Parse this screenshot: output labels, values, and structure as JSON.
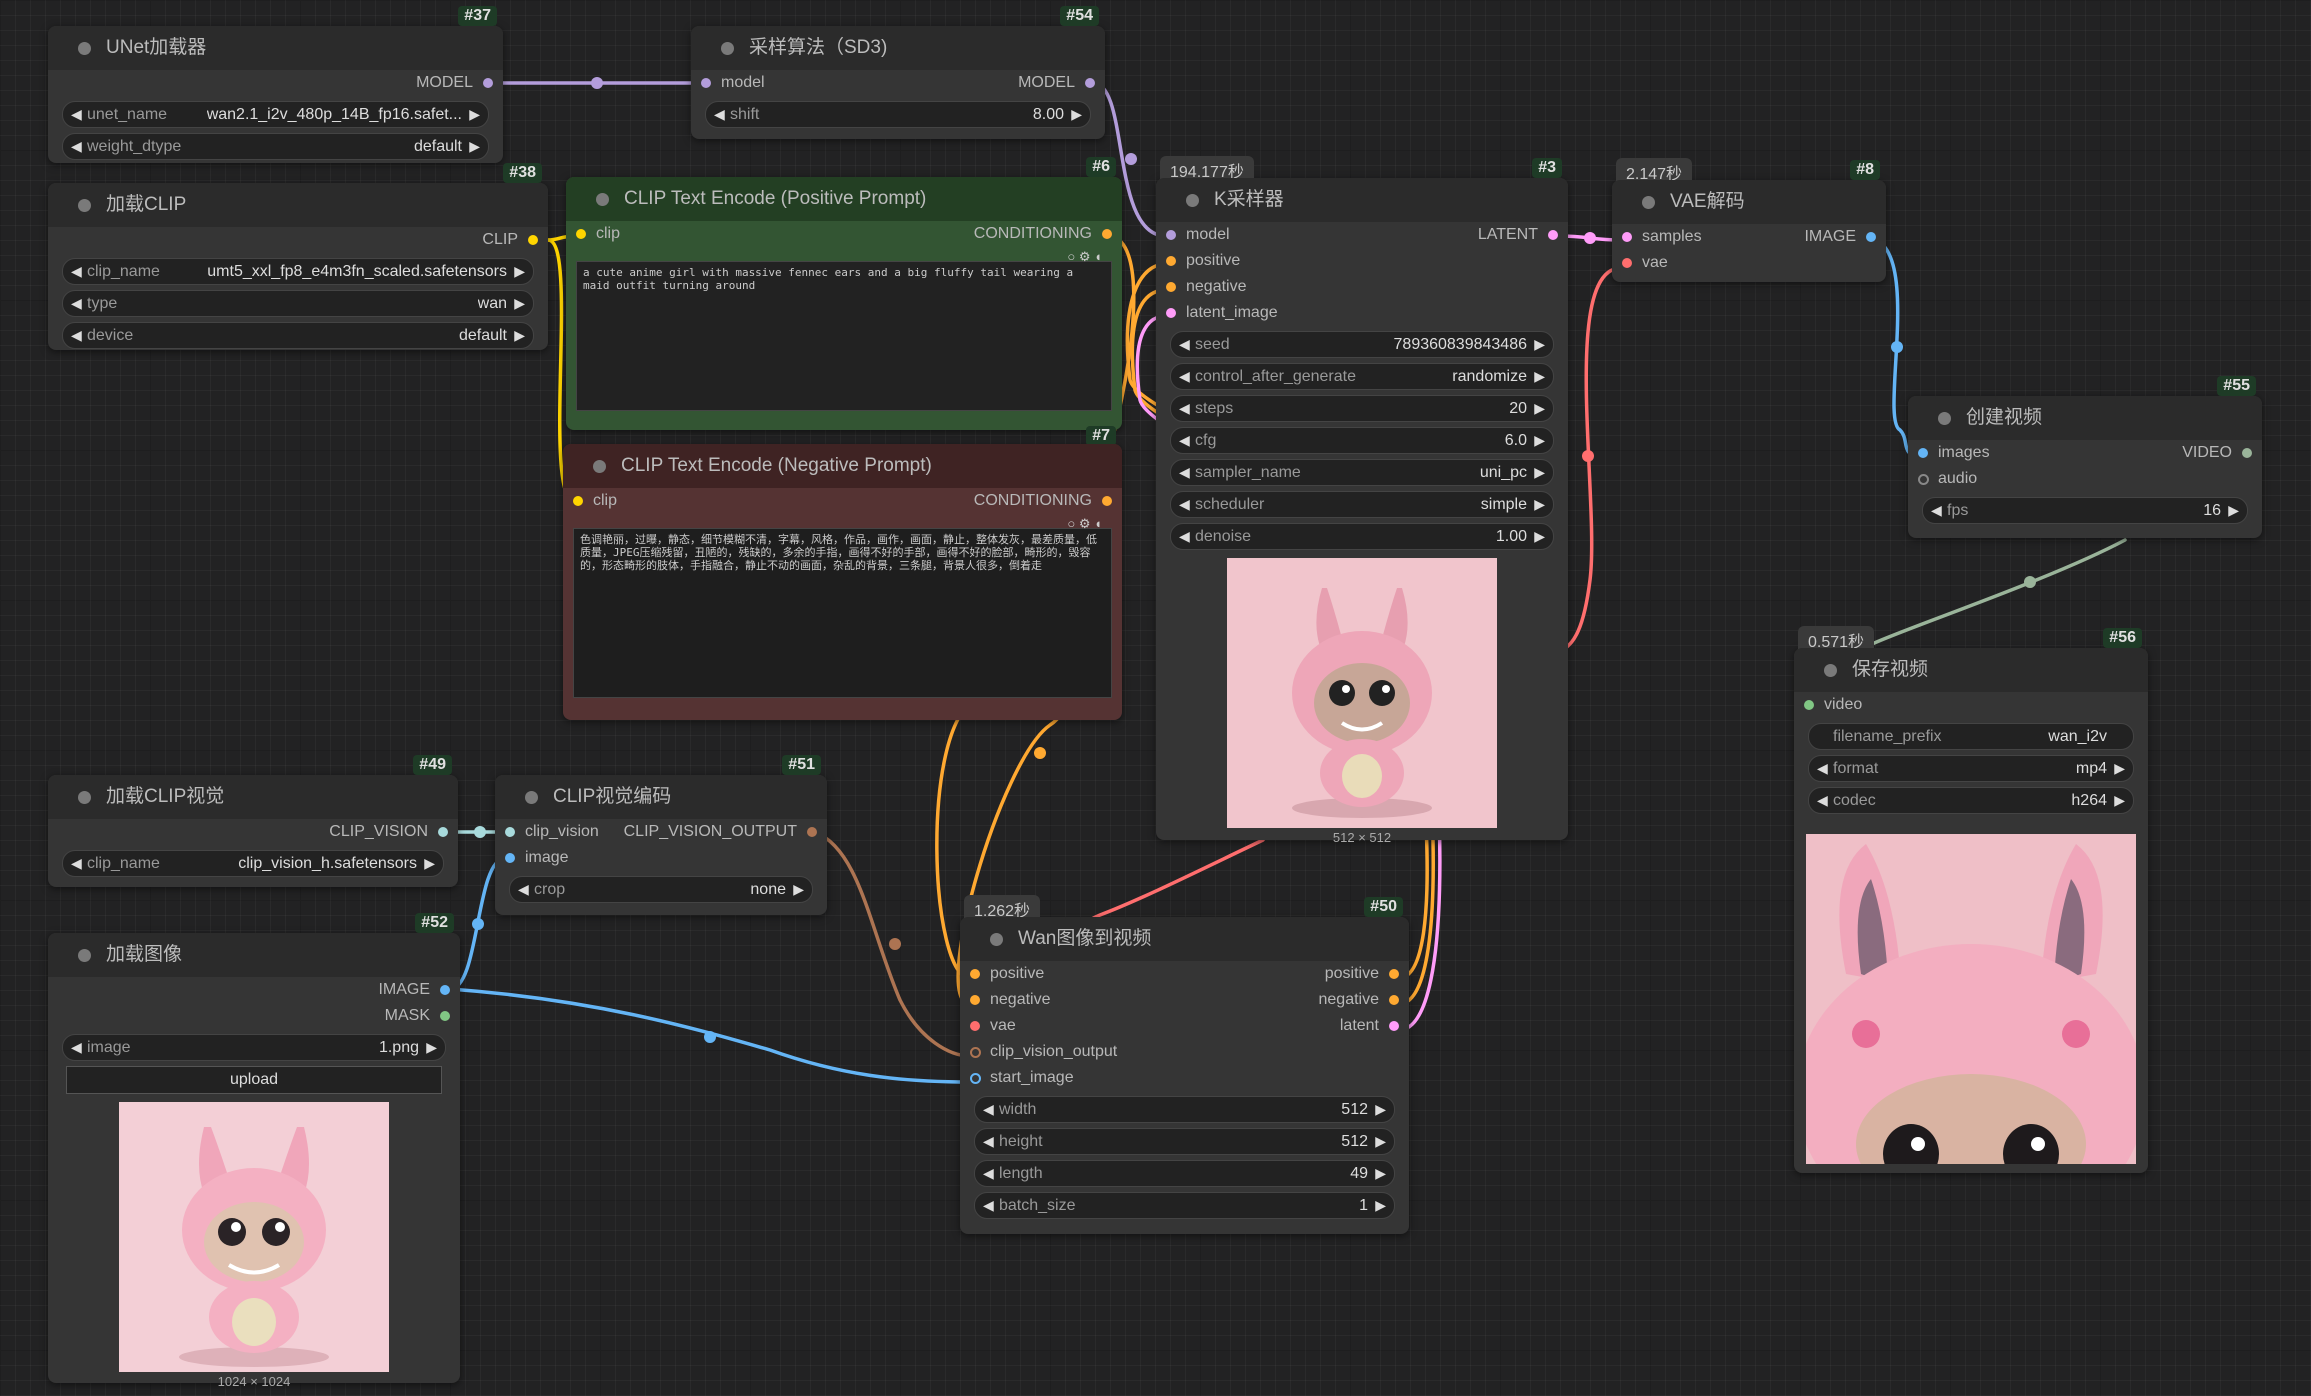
{
  "nodes": {
    "unet": {
      "id": "#37",
      "title": "UNet加载器",
      "out": "MODEL",
      "w1": {
        "label": "unet_name",
        "value": "wan2.1_i2v_480p_14B_fp16.safet..."
      },
      "w2": {
        "label": "weight_dtype",
        "value": "default"
      }
    },
    "sd3": {
      "id": "#54",
      "title": "采样算法（SD3)",
      "in": "model",
      "out": "MODEL",
      "w1": {
        "label": "shift",
        "value": "8.00"
      }
    },
    "clipload": {
      "id": "#38",
      "title": "加载CLIP",
      "out": "CLIP",
      "w1": {
        "label": "clip_name",
        "value": "umt5_xxl_fp8_e4m3fn_scaled.safetensors"
      },
      "w2": {
        "label": "type",
        "value": "wan"
      },
      "w3": {
        "label": "device",
        "value": "default"
      }
    },
    "pos": {
      "id": "#6",
      "title": "CLIP Text Encode (Positive Prompt)",
      "in": "clip",
      "out": "CONDITIONING",
      "text": "a cute anime girl with massive fennec ears and a big fluffy tail wearing a maid outfit turning around"
    },
    "neg": {
      "id": "#7",
      "title": "CLIP Text Encode (Negative Prompt)",
      "in": "clip",
      "out": "CONDITIONING",
      "text": "色调艳丽，过曝，静态，细节模糊不清，字幕，风格，作品，画作，画面，静止，整体发灰，最差质量，低质量，JPEG压缩残留，丑陋的，残缺的，多余的手指，画得不好的手部，画得不好的脸部，畸形的，毁容的，形态畸形的肢体，手指融合，静止不动的画面，杂乱的背景，三条腿，背景人很多，倒着走"
    },
    "ksampler": {
      "id": "#3",
      "title": "K采样器",
      "time": "194.177秒",
      "out": "LATENT",
      "inputs": [
        "model",
        "positive",
        "negative",
        "latent_image"
      ],
      "widgets": [
        {
          "label": "seed",
          "value": "789360839843486"
        },
        {
          "label": "control_after_generate",
          "value": "randomize"
        },
        {
          "label": "steps",
          "value": "20"
        },
        {
          "label": "cfg",
          "value": "6.0"
        },
        {
          "label": "sampler_name",
          "value": "uni_pc"
        },
        {
          "label": "scheduler",
          "value": "simple"
        },
        {
          "label": "denoise",
          "value": "1.00"
        }
      ],
      "caption": "512 × 512"
    },
    "vae": {
      "id": "#8",
      "title": "VAE解码",
      "time": "2.147秒",
      "in1": "samples",
      "in2": "vae",
      "out": "IMAGE"
    },
    "video": {
      "id": "#55",
      "title": "创建视频",
      "in1": "images",
      "in2": "audio",
      "out": "VIDEO",
      "w1": {
        "label": "fps",
        "value": "16"
      }
    },
    "save": {
      "id": "#56",
      "title": "保存视频",
      "time": "0.571秒",
      "in": "video",
      "w1": {
        "label": "filename_prefix",
        "value": "wan_i2v"
      },
      "w2": {
        "label": "format",
        "value": "mp4"
      },
      "w3": {
        "label": "codec",
        "value": "h264"
      }
    },
    "clipvis": {
      "id": "#49",
      "title": "加载CLIP视觉",
      "out": "CLIP_VISION",
      "w1": {
        "label": "clip_name",
        "value": "clip_vision_h.safetensors"
      }
    },
    "cvenc": {
      "id": "#51",
      "title": "CLIP视觉编码",
      "in1": "clip_vision",
      "in2": "image",
      "out": "CLIP_VISION_OUTPUT",
      "w1": {
        "label": "crop",
        "value": "none"
      }
    },
    "loadimg": {
      "id": "#52",
      "title": "加载图像",
      "out1": "IMAGE",
      "out2": "MASK",
      "w1": {
        "label": "image",
        "value": "1.png"
      },
      "btn": "upload",
      "caption": "1024 × 1024"
    },
    "wan": {
      "id": "#50",
      "title": "Wan图像到视频",
      "time": "1.262秒",
      "inputs": [
        "positive",
        "negative",
        "vae",
        "clip_vision_output",
        "start_image"
      ],
      "outputs": [
        "positive",
        "negative",
        "latent"
      ],
      "widgets": [
        {
          "label": "width",
          "value": "512"
        },
        {
          "label": "height",
          "value": "512"
        },
        {
          "label": "length",
          "value": "49"
        },
        {
          "label": "batch_size",
          "value": "1"
        }
      ]
    }
  },
  "colors": {
    "model": "#b39ddb",
    "clip": "#ffd500",
    "conditioning": "#ffa931",
    "latent": "#ff9cf9",
    "vae": "#ff6e6e",
    "image": "#64b5f6",
    "clip_vision": "#a8dadc",
    "clip_vision_output": "#ad7452",
    "video": "#9ab49a",
    "mask": "#81c784"
  }
}
